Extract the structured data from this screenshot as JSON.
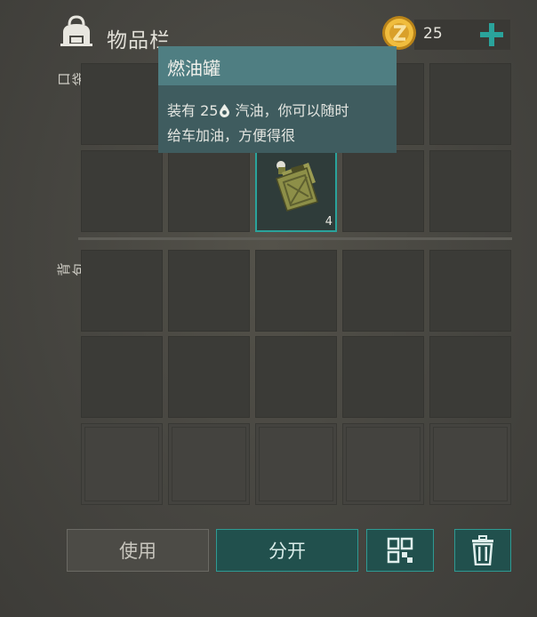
{
  "header": {
    "title": "物品栏",
    "backpack_icon": "backpack-icon",
    "coin_icon": "z-coin-icon",
    "coin_count": "25",
    "add_icon": "plus-icon"
  },
  "sections": {
    "pocket_label": "口袋",
    "backpack_label": "背包"
  },
  "selected_item": {
    "name": "燃油罐",
    "icon": "jerrycan-icon",
    "count": "4",
    "description_line1_prefix": "装有 25",
    "description_line1_icon": "fuel-drop-icon",
    "description_line1_suffix": " 汽油，你可以随时",
    "description_line2": "给车加油，方便得很"
  },
  "buttons": {
    "use_label": "使用",
    "split_label": "分开",
    "sort_icon": "grid-sort-icon",
    "trash_icon": "trash-icon"
  },
  "colors": {
    "accent": "#2aa39b",
    "coin": "#e9b23a",
    "tooltip_head": "#4f7e82",
    "tooltip_body": "#3f5c5f"
  }
}
